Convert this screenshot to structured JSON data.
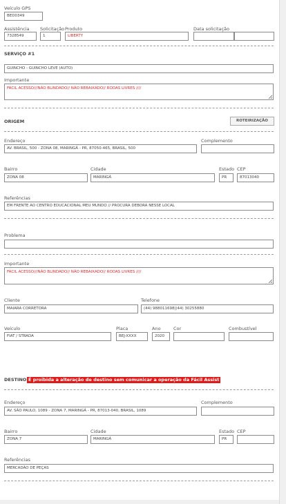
{
  "gps": {
    "label": "Veículo GPS",
    "value": "BED0349"
  },
  "service_header": {
    "assistencia": {
      "label": "Assistência",
      "value": "7328549"
    },
    "solicitacao": {
      "label": "Solicitação",
      "value": "1"
    },
    "produto": {
      "label": "Produto",
      "value": "LIBERTY"
    },
    "data_solicitacao": {
      "label": "Data solicitação",
      "date": "",
      "time": ""
    }
  },
  "servico": {
    "title": "SERVIÇO #1",
    "tipo": "GUINCHO - GUINCHO LEVE (AUTO)",
    "importante_label": "Importante",
    "importante": "FACIL ACESSO///NÃO BLINDADO// NÃO REBAIXADO// RODAS LIVRES ////"
  },
  "origem": {
    "title": "ORIGEM",
    "button": "ROTEIRIZAÇÃO",
    "endereco_label": "Endereço",
    "endereco": "AV. BRASIL, 500 - ZONA 08, MARINGÁ - PR, 87050-465, BRASIL, 500",
    "complemento_label": "Complemento",
    "complemento": "",
    "bairro_label": "Bairro",
    "bairro": "ZONA 08",
    "cidade_label": "Cidade",
    "cidade": "MARINGÁ",
    "estado_label": "Estado",
    "estado": "PR",
    "cep_label": "CEP",
    "cep": "87013040",
    "referencias_label": "Referências",
    "referencias": "EM FRENTE AO CENTRO EDUCACIONAL MEU MUNDO // PROCURA DEBORA NESSE LOCAL"
  },
  "problema": {
    "label": "Problema",
    "value": ""
  },
  "importante2": {
    "label": "Importante",
    "value": "FACIL ACESSO///NÃO BLINDADO// NÃO REBAIXADO// RODAS LIVRES ////"
  },
  "cliente": {
    "cliente_label": "Cliente",
    "cliente": "MAIARA CORRETORA",
    "telefone_label": "Telefone",
    "telefone": "(44) 988011698|(44) 30255880"
  },
  "veiculo": {
    "veiculo_label": "Veículo",
    "veiculo": "FIAT / STRADA",
    "placa_label": "Placa",
    "placa": "BEJ-XXXX",
    "ano_label": "Ano",
    "ano": "2020",
    "cor_label": "Cor",
    "cor": "",
    "combustivel_label": "Combustível",
    "combustivel": ""
  },
  "destino": {
    "title": "DESTINO",
    "warning": "É proibida a alteração de destino sem comunicar a operação da Fácil Assist",
    "endereco_label": "Endereço",
    "endereco": "AV. SÃO PAULO, 1089 - ZONA 7, MARINGÁ - PR, 87013-040, BRASIL, 1089",
    "complemento_label": "Complemento",
    "complemento": "",
    "bairro_label": "Bairro",
    "bairro": "ZONA 7",
    "cidade_label": "Cidade",
    "cidade": "MARINGÁ",
    "estado_label": "Estado",
    "estado": "PR",
    "cep_label": "CEP",
    "cep": "",
    "referencias_label": "Referências",
    "referencias": "MERCADÃO DE PEÇAS"
  }
}
